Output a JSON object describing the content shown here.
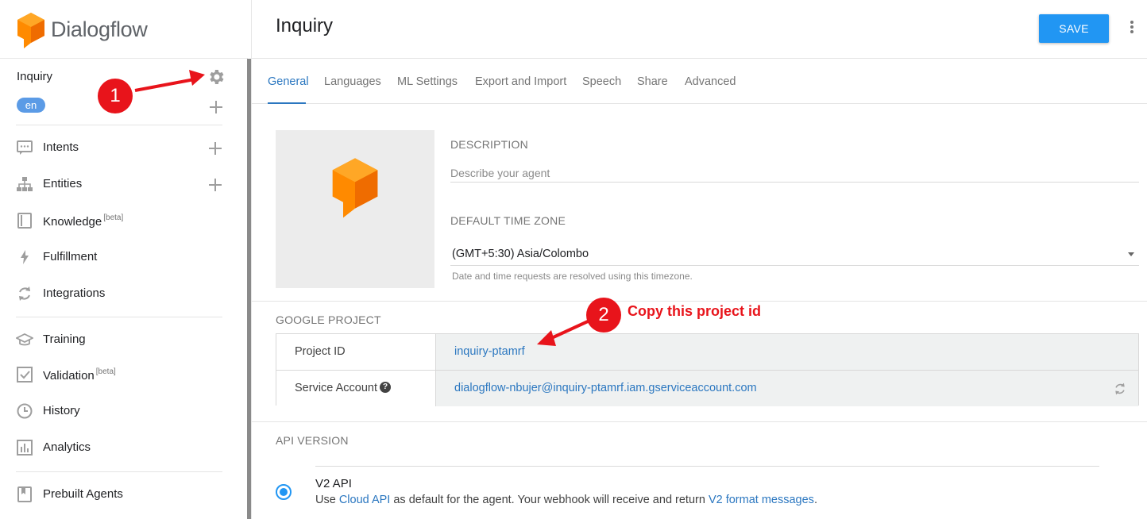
{
  "brand": {
    "name": "Dialogflow"
  },
  "sidebar": {
    "agent_name": "Inquiry",
    "language_badge": "en",
    "items": [
      {
        "label": "Intents",
        "tag": ""
      },
      {
        "label": "Entities",
        "tag": ""
      },
      {
        "label": "Knowledge",
        "tag": "[beta]"
      },
      {
        "label": "Fulfillment",
        "tag": ""
      },
      {
        "label": "Integrations",
        "tag": ""
      },
      {
        "label": "Training",
        "tag": ""
      },
      {
        "label": "Validation",
        "tag": "[beta]"
      },
      {
        "label": "History",
        "tag": ""
      },
      {
        "label": "Analytics",
        "tag": ""
      },
      {
        "label": "Prebuilt Agents",
        "tag": ""
      }
    ]
  },
  "header": {
    "title": "Inquiry",
    "save_label": "SAVE"
  },
  "tabs": [
    "General",
    "Languages",
    "ML Settings",
    "Export and Import",
    "Speech",
    "Share",
    "Advanced"
  ],
  "general": {
    "description_label": "DESCRIPTION",
    "description_placeholder": "Describe your agent",
    "timezone_label": "DEFAULT TIME ZONE",
    "timezone_value": "(GMT+5:30) Asia/Colombo",
    "timezone_hint": "Date and time requests are resolved using this timezone."
  },
  "google_project": {
    "section_title": "GOOGLE PROJECT",
    "project_id_label": "Project ID",
    "project_id_value": "inquiry-ptamrf",
    "service_account_label": "Service Account",
    "service_account_value": "dialogflow-nbujer@inquiry-ptamrf.iam.gserviceaccount.com"
  },
  "api_version": {
    "section_title": "API VERSION",
    "option_title": "V2 API",
    "desc_before": "Use ",
    "desc_link1": "Cloud API",
    "desc_middle": " as default for the agent. Your webhook will receive and return ",
    "desc_link2": "V2 format messages",
    "desc_after": "."
  },
  "annotations": {
    "step1": "1",
    "step2": "2",
    "step2_text": "Copy this project id",
    "color": "#e8141b"
  },
  "colors": {
    "accent": "#2196f3",
    "link": "#2b77c0",
    "logo_orange": "#ff8a00"
  }
}
